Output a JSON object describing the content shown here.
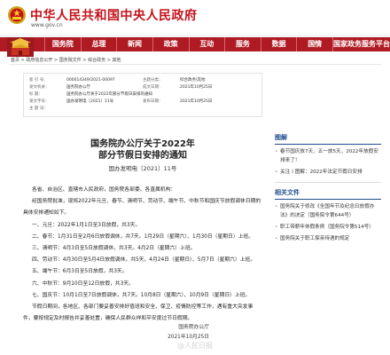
{
  "header": {
    "site_title": "中华人民共和国中央人民政府",
    "site_url": "www.gov.cn",
    "emblem_icon": "national-emblem-icon",
    "brand_color": "#c4121a"
  },
  "nav": {
    "items": [
      "国务院",
      "总理",
      "新闻",
      "政策",
      "互动",
      "服务",
      "数据",
      "国情",
      "国家政务服务平台"
    ],
    "home_icon": "tiananmen-icon",
    "bar_color": "#b01a23"
  },
  "breadcrumb": "首页 > 政府信息公开 > 国务院文件 > 综合政务 > 其他",
  "meta": {
    "rows": [
      {
        "k": "索 引 号：",
        "v": "000014349/2021-00097",
        "k2": "主题分类：",
        "v2": "综合政务\\其他"
      },
      {
        "k": "发文机关：",
        "v": "国务院办公厅",
        "k2": "成文日期：",
        "v2": "2021年10月25日"
      },
      {
        "k": "标    题：",
        "v": "国务院办公厅关于2022年部分节假日安排的通知",
        "k2": "",
        "": ""
      },
      {
        "k": "发文字号：",
        "v": "国办发明电〔2021〕11号",
        "k2": "发布日期：",
        "v2": "2021年10月25日"
      },
      {
        "k": "主 题 词：",
        "v": "",
        "k2": "",
        "": ""
      }
    ]
  },
  "doc": {
    "title_line1": "国务院办公厅关于2022年",
    "title_line2": "部分节假日安排的通知",
    "doc_no": "国办发明电〔2021〕11号",
    "paragraphs": [
      "各省、自治区、直辖市人民政府，国务院各部委、各直属机构：",
      "经国务院批准，现将2022年元旦、春节、清明节、劳动节、端午节、中秋节和国庆节放假调休日期的具体安排通知如下。",
      "一、元旦：2022年1月1日至3日放假，共3天。",
      "二、春节：1月31日至2月6日放假调休，共7天。1月29日（星期六）、1月30日（星期日）上班。",
      "三、清明节：4月3日至5日放假调休，共3天。4月2日（星期六）上班。",
      "四、劳动节：4月30日至5月4日放假调休，共5天。4月24日（星期日）、5月7日（星期六）上班。",
      "五、端午节：6月3日至5日放假，共3天。",
      "六、中秋节：9月10日至12日放假，共3天。",
      "七、国庆节：10月1日至7日放假调休，共7天。10月8日（星期六）、10月9日（星期日）上班。",
      "节假日期间，各地区、各部门要妥善安排好值班和安全、保卫、疫情防控等工作，遇有重大突发事件，要按规定及时报告并妥善处置，确保人民群众祥和平安度过节日假期。"
    ],
    "signature": "国务院办公厅",
    "sign_date": "2021年10月25日"
  },
  "sidebar": {
    "section1_title": "图解",
    "section1_items": [
      "春节国庆放7天、五一放5天，2022年放假安排来了！",
      "关注丨图解：2022年法定节假日安排"
    ],
    "section2_title": "相关文件",
    "section2_items": [
      "国务院关于修改《全国年节及纪念日放假办法》的决定（国务院令第644号）",
      "职工带薪年休假条例（国务院令第514号）",
      "国务院关于职工探亲待遇的规定"
    ]
  },
  "watermark": "@人民日报"
}
